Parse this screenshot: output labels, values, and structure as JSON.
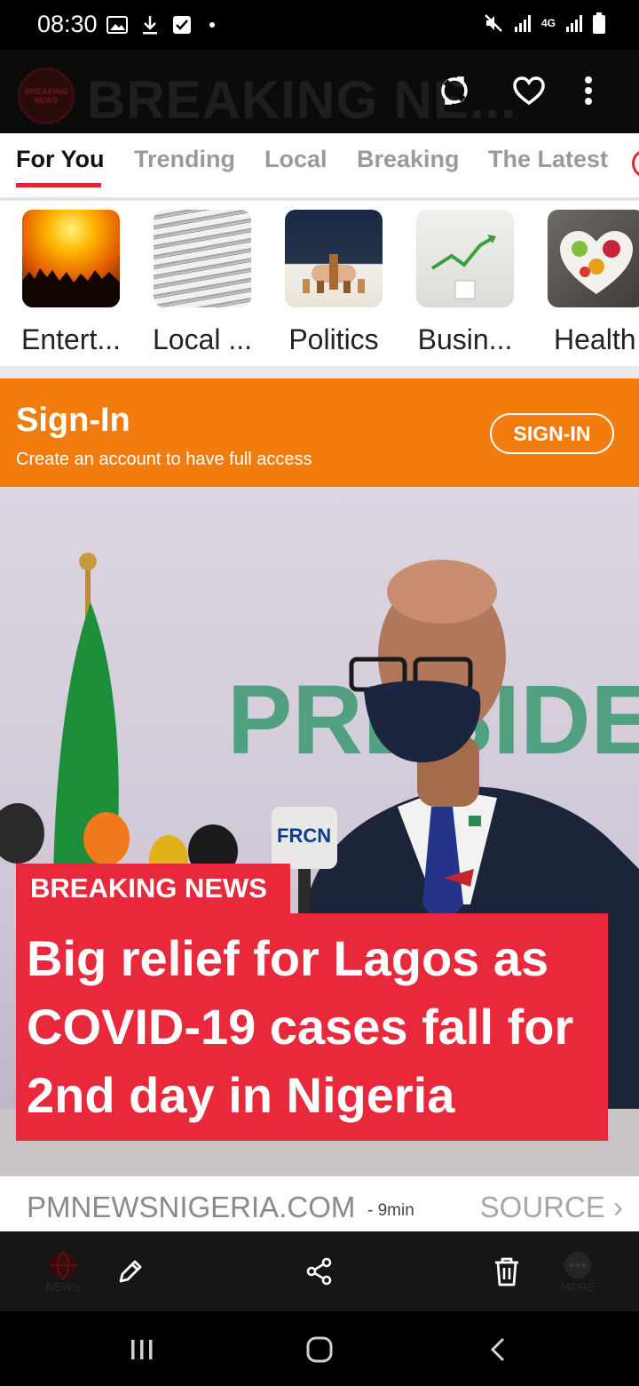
{
  "status_bar": {
    "time": "08:30",
    "network": "4G"
  },
  "app_header": {
    "brand_title": "BREAKING NE...",
    "logo_text": "BREAKING NEWS"
  },
  "tabs": [
    {
      "label": "For You",
      "active": true
    },
    {
      "label": "Trending",
      "active": false
    },
    {
      "label": "Local",
      "active": false
    },
    {
      "label": "Breaking",
      "active": false
    },
    {
      "label": "The Latest",
      "active": false
    }
  ],
  "categories": [
    {
      "label": "Entert...",
      "icon": "concert-image"
    },
    {
      "label": "Local ...",
      "icon": "newspapers-image"
    },
    {
      "label": "Politics",
      "icon": "chess-image"
    },
    {
      "label": "Busin...",
      "icon": "growth-chart-plant-image"
    },
    {
      "label": "Health",
      "icon": "healthy-food-image"
    }
  ],
  "signin_banner": {
    "title": "Sign-In",
    "subtitle": "Create an account to have full access",
    "button_label": "SIGN-IN"
  },
  "article": {
    "badge": "BREAKING NEWS",
    "headline": "Big relief for Lagos as COVID-19 cases fall for 2nd day in Nigeria",
    "source_domain": "PMNEWSNIGERIA.COM",
    "time_ago": "- 9min",
    "source_link": "SOURCE ›",
    "hero_wall_text": "PRESIDE",
    "mic_text": "FRCN"
  },
  "action_bar": {
    "left_label": "NEWS",
    "right_label": "MORE"
  },
  "colors": {
    "accent": "#e8283b",
    "banner": "#f27c0e",
    "tab_underline": "#e0272f"
  }
}
